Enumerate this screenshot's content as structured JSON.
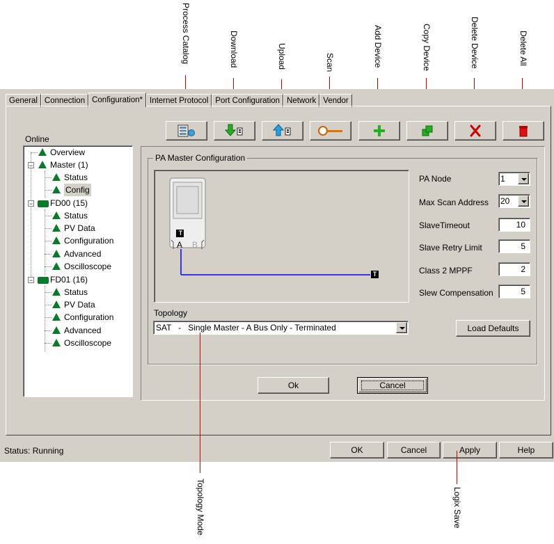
{
  "callouts": {
    "process_catalog": "Process Catalog",
    "download": "Download",
    "upload": "Upload",
    "scan": "Scan",
    "add_device": "Add Device",
    "copy_device": "Copy Device",
    "delete_device": "Delete Device",
    "delete_all": "Delete All",
    "topology_mode": "Topology Mode",
    "logix_save": "Logix Save"
  },
  "tabs": [
    "General",
    "Connection",
    "Configuration*",
    "Internet Protocol",
    "Port Configuration",
    "Network",
    "Vendor"
  ],
  "online_label": "Online",
  "tree": {
    "overview": "Overview",
    "master": "Master (1)",
    "master_status": "Status",
    "master_config": "Config",
    "fd00": "FD00 (15)",
    "fd00_status": "Status",
    "fd00_pv": "PV Data",
    "fd00_config": "Configuration",
    "fd00_adv": "Advanced",
    "fd00_osc": "Oscilloscope",
    "fd01": "FD01 (16)",
    "fd01_status": "Status",
    "fd01_pv": "PV Data",
    "fd01_config": "Configuration",
    "fd01_adv": "Advanced",
    "fd01_osc": "Oscilloscope"
  },
  "group_title": "PA Master Configuration",
  "diagram": {
    "terminator": "T",
    "bus_a": "A",
    "bus_b": "B"
  },
  "fields": {
    "pa_node_label": "PA Node",
    "pa_node_value": "1",
    "max_scan_label": "Max Scan Address",
    "max_scan_value": "20",
    "slave_timeout_label": "SlaveTimeout",
    "slave_timeout_value": "10",
    "slave_retry_label": "Slave Retry Limit",
    "slave_retry_value": "5",
    "class2_label": "Class 2 MPPF",
    "class2_value": "2",
    "slew_label": "Slew Compensation",
    "slew_value": "5"
  },
  "topology_label": "Topology",
  "topology_value": "SAT   -   Single Master - A Bus Only - Terminated",
  "load_defaults": "Load Defaults",
  "ok_inner": "Ok",
  "cancel_inner": "Cancel",
  "status_text": "Status:  Running",
  "bottom_buttons": {
    "ok": "OK",
    "cancel": "Cancel",
    "apply": "Apply",
    "help": "Help"
  },
  "colors": {
    "accent_red": "#cc0000",
    "icon_green": "#0a7a2a",
    "bus_blue": "#0000ff",
    "window_bg": "#d4d0c8"
  }
}
